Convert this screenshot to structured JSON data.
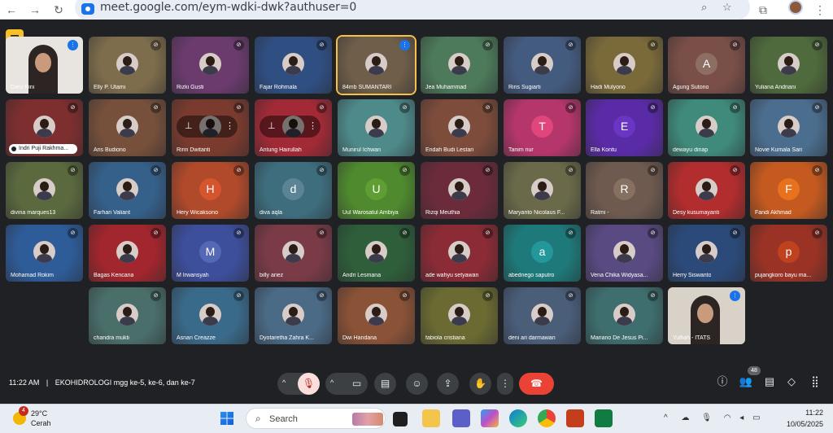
{
  "browser": {
    "url": "meet.google.com/eym-wdki-dwk?authuser=0",
    "back_icon": "arrow-left-icon",
    "forward_icon": "arrow-right-icon",
    "reload_icon": "reload-icon"
  },
  "tiles": [
    {
      "name": "Daru Rini",
      "muted": false,
      "speaking": true,
      "bg": "#e8e4df",
      "video": true
    },
    {
      "name": "Elly P. Utami",
      "muted": true,
      "bg": "#7e6d4c",
      "avatar": true
    },
    {
      "name": "Rizki Gusti",
      "muted": true,
      "bg": "#6b3b6e",
      "avatar": true
    },
    {
      "name": "Fajar Rohmala",
      "muted": true,
      "bg": "#2f4f83",
      "avatar": true
    },
    {
      "name": "84mb SUMANTARI",
      "muted": false,
      "active": true,
      "bg": "#6f5e49",
      "avatar": true
    },
    {
      "name": "Jea Muhammad",
      "muted": true,
      "bg": "#4d7a5a",
      "avatar": true
    },
    {
      "name": "Riris Sugiarti",
      "muted": true,
      "bg": "#445b80",
      "avatar": true
    },
    {
      "name": "Hadi Mulyono",
      "muted": true,
      "bg": "#7a6a3a",
      "avatar": true
    },
    {
      "name": "Agung Sutono",
      "muted": true,
      "bg": "#7a4f47",
      "initial": "A",
      "initial_bg": "#8d6e63"
    },
    {
      "name": "Yuliana Andriani",
      "muted": true,
      "bg": "#4f6a3c",
      "avatar": true
    },
    {
      "name": "Indri Puji Rakhma...",
      "muted": true,
      "bg": "#7d2e2e",
      "avatar": true,
      "chip": true
    },
    {
      "name": "Aris Budiono",
      "muted": true,
      "bg": "#76503b",
      "avatar": true
    },
    {
      "name": "Ririn Dwitanti",
      "muted": true,
      "bg": "#7a3b2e",
      "avatar": true,
      "pinbar": true
    },
    {
      "name": "Antung Hairullah",
      "muted": true,
      "bg": "#a12a36",
      "avatar": true,
      "pinbar": true
    },
    {
      "name": "Munirul Ichwan",
      "muted": true,
      "bg": "#4f8a8a",
      "avatar": true
    },
    {
      "name": "Endah Budi Lestari",
      "muted": true,
      "bg": "#7d4c3b",
      "avatar": true
    },
    {
      "name": "Tanim nur",
      "muted": true,
      "bg": "#b5366b",
      "initial": "T",
      "initial_bg": "#e0457b"
    },
    {
      "name": "Ella Kontu",
      "muted": true,
      "bg": "#5a2ba6",
      "initial": "E",
      "initial_bg": "#6a35c2"
    },
    {
      "name": "dewayu dinap",
      "muted": true,
      "bg": "#3f8a7a",
      "avatar": true
    },
    {
      "name": "Novie Kumala Sari",
      "muted": true,
      "bg": "#4b6e8e",
      "avatar": true
    },
    {
      "name": "divina marques13",
      "muted": true,
      "bg": "#5b6a3e",
      "avatar": true
    },
    {
      "name": "Farhan Valiant",
      "muted": true,
      "bg": "#35608a",
      "avatar": true
    },
    {
      "name": "Hery Wicaksono",
      "muted": true,
      "bg": "#b04a2b",
      "initial": "H",
      "initial_bg": "#d4552e"
    },
    {
      "name": "diva aqla",
      "muted": true,
      "bg": "#3e6e7e",
      "initial": "d",
      "initial_bg": "#5b8595"
    },
    {
      "name": "Uul Warosatul Ambiya",
      "muted": true,
      "bg": "#4f8a2e",
      "initial": "U",
      "initial_bg": "#5f9e32"
    },
    {
      "name": "Rizqi Meuthia",
      "muted": true,
      "bg": "#6b2b3b",
      "avatar": true
    },
    {
      "name": "Maryanto Nicolaus F...",
      "muted": true,
      "bg": "#6a6a4a",
      "avatar": true
    },
    {
      "name": "Ratmi -",
      "muted": true,
      "bg": "#6e5a4e",
      "initial": "R",
      "initial_bg": "#86705f"
    },
    {
      "name": "Desy kusumayanti",
      "muted": true,
      "bg": "#b22d2d",
      "avatar": true
    },
    {
      "name": "Fandi Akhmad",
      "muted": true,
      "bg": "#c45a1f",
      "initial": "F",
      "initial_bg": "#e8711e"
    },
    {
      "name": "Mohamad Rokim",
      "muted": true,
      "bg": "#2e5c99",
      "avatar": true
    },
    {
      "name": "Bagas Kencana",
      "muted": true,
      "bg": "#a1262d",
      "avatar": true
    },
    {
      "name": "M Irwansyah",
      "muted": true,
      "bg": "#3d4e9a",
      "initial": "M",
      "initial_bg": "#5468b5"
    },
    {
      "name": "billy ariez",
      "muted": true,
      "bg": "#7a3b47",
      "avatar": true
    },
    {
      "name": "Andri Lesmana",
      "muted": true,
      "bg": "#2e5e3a",
      "avatar": true
    },
    {
      "name": "ade wahyu setyawan",
      "muted": true,
      "bg": "#8a2b35",
      "avatar": true
    },
    {
      "name": "abednego saputro",
      "muted": true,
      "bg": "#1e7a7a",
      "initial": "a",
      "initial_bg": "#23979a"
    },
    {
      "name": "Vena Chika Widyasa...",
      "muted": true,
      "bg": "#5a4a82",
      "avatar": true
    },
    {
      "name": "Herry Siswanto",
      "muted": true,
      "bg": "#2b4a7a",
      "avatar": true
    },
    {
      "name": "pujangkoro bayu ma...",
      "muted": true,
      "bg": "#9a3325",
      "initial": "p",
      "initial_bg": "#c0411e"
    },
    {
      "name": "chandra mukti",
      "muted": true,
      "bg": "#4a6e6a",
      "avatar": true
    },
    {
      "name": "Asnan Creazze",
      "muted": true,
      "bg": "#3a6a8a",
      "avatar": true
    },
    {
      "name": "Dyotaretha Zahra K...",
      "muted": true,
      "bg": "#4a6a86",
      "avatar": true
    },
    {
      "name": "Dwi Handana",
      "muted": true,
      "bg": "#8a5236",
      "avatar": true
    },
    {
      "name": "fabiola cristiana",
      "muted": true,
      "bg": "#6a6a32",
      "avatar": true
    },
    {
      "name": "deni ari darmawan",
      "muted": true,
      "bg": "#4a5e7a",
      "avatar": true
    },
    {
      "name": "Mariano De Jesus Pi...",
      "muted": true,
      "bg": "#3e6e6e",
      "avatar": true
    },
    {
      "name": "Yulfiah - ITATS",
      "muted": false,
      "bg": "#d9d2c8",
      "video": true
    }
  ],
  "meeting": {
    "time": "11:22 AM",
    "separator": "|",
    "title": "EKOHIDROLOGI mgg ke-5, ke-6, dan ke-7",
    "participant_count": "48"
  },
  "controls": {
    "mic_icon": "mic-off-icon",
    "camera_icon": "camera-icon",
    "captions_icon": "captions-icon",
    "emoji_icon": "emoji-icon",
    "present_icon": "present-icon",
    "hand_icon": "raise-hand-icon",
    "more_icon": "more-vert-icon",
    "end_call_icon": "end-call-icon",
    "end_call_color": "#ea4335",
    "mic_off_bg": "#f9dedc"
  },
  "taskbar": {
    "weather_temp": "29°C",
    "weather_cond": "Cerah",
    "weather_badge": "4",
    "search_label": "Search",
    "time": "11:22",
    "date": "10/05/2025"
  }
}
